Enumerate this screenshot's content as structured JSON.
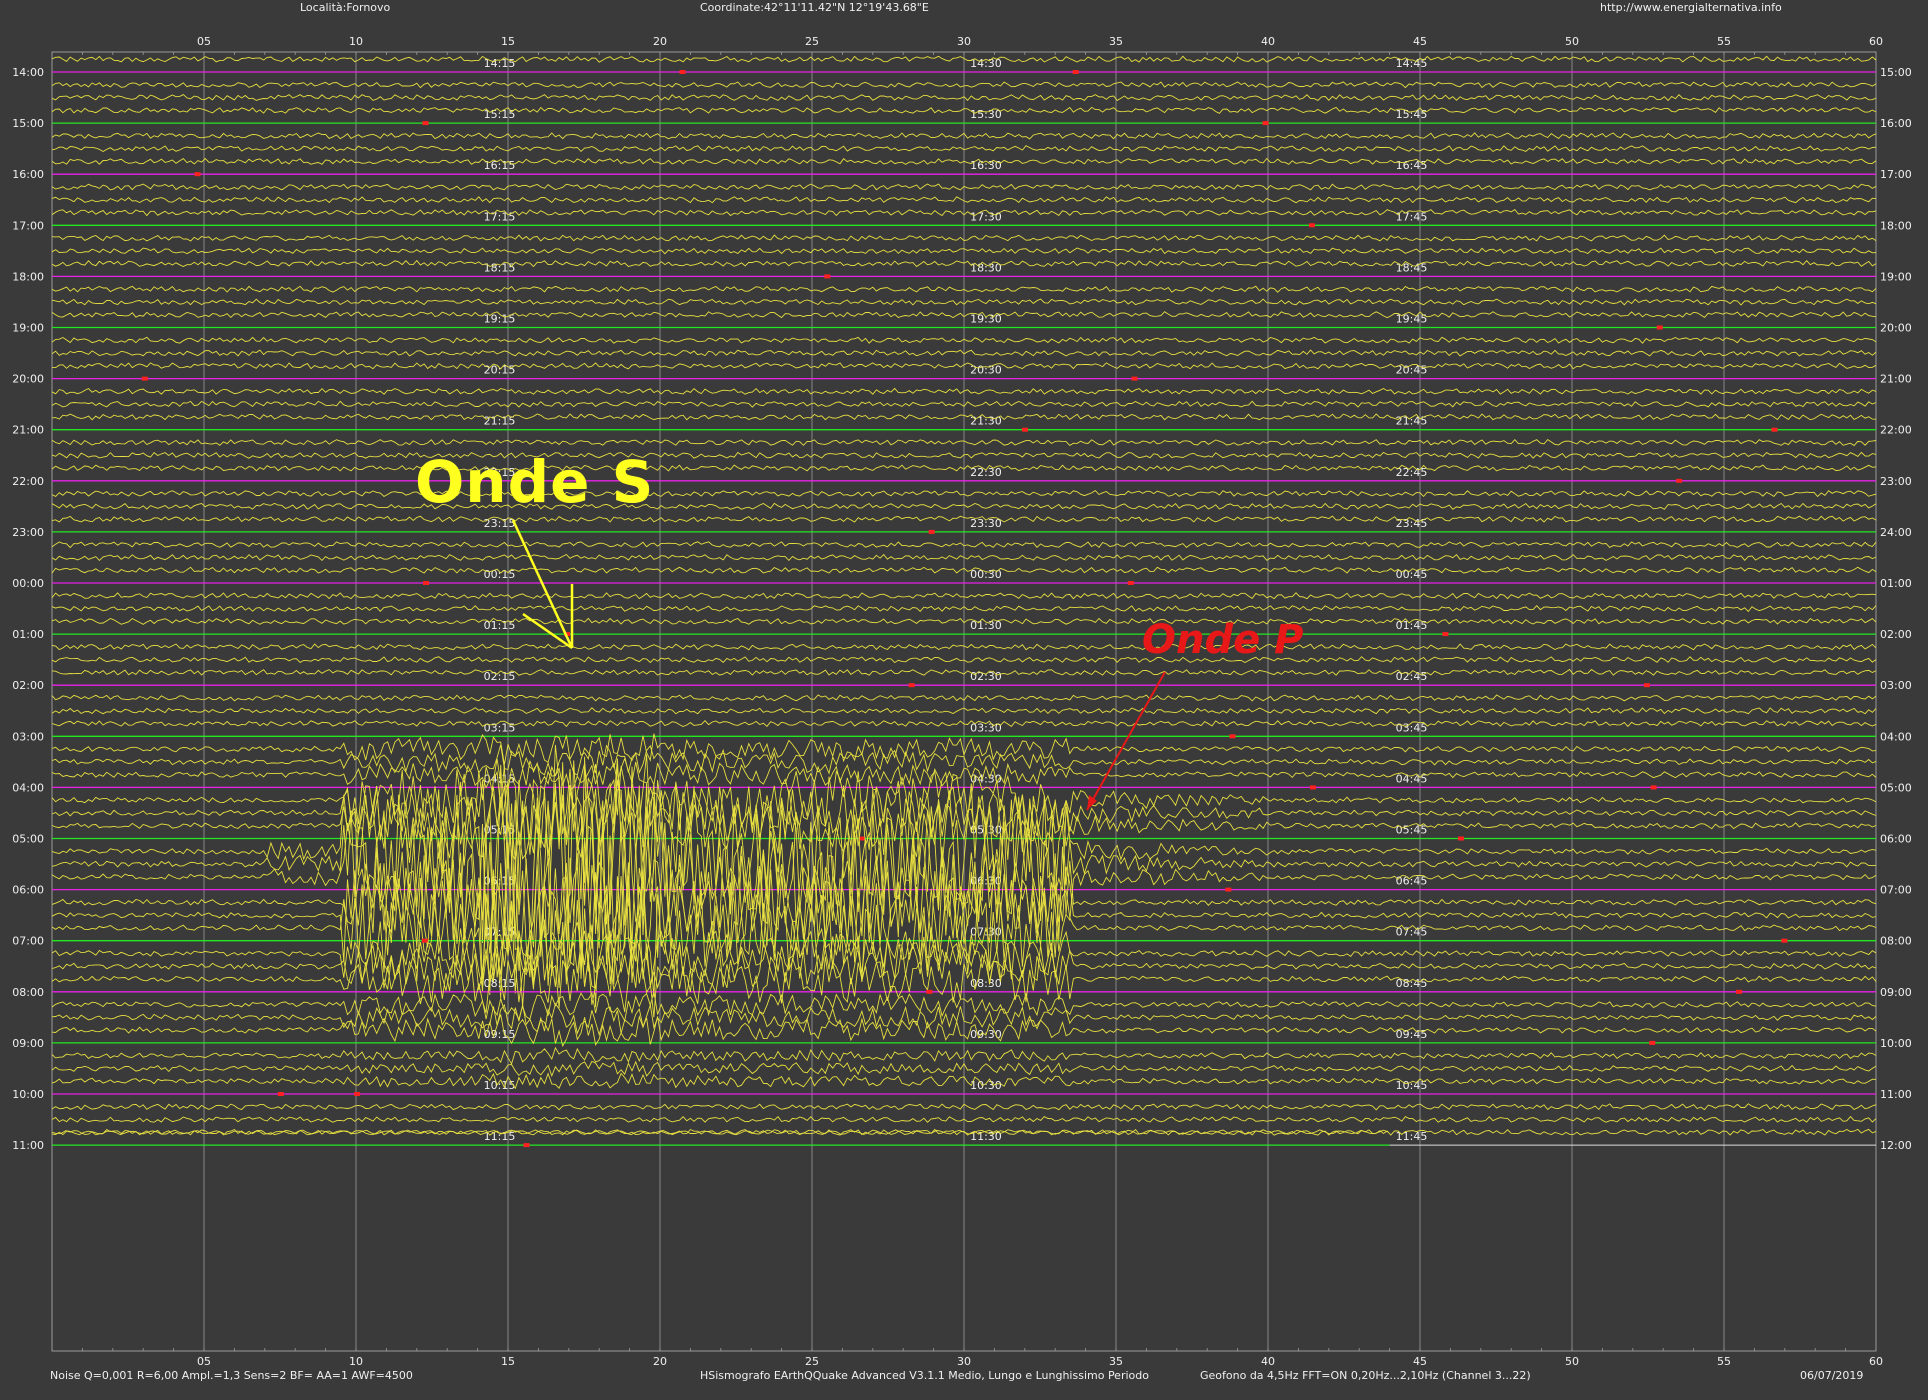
{
  "header": {
    "location": "Località:Fornovo",
    "coordinates": "Coordinate:42°11'11.42\"N  12°19'43.68\"E",
    "website": "http://www.energialternativa.info"
  },
  "footer": {
    "settings": "Noise Q=0,001 R=6,00 Ampl.=1,3 Sens=2 BF= AA=1 AWF=4500",
    "software": "HSismografo  EArthQQuake Advanced V3.1.1  Medio, Lungo e Lunghissimo Periodo",
    "sensor": "Geofono da 4,5Hz FFT=ON 0,20Hz...2,10Hz      (Channel 3...22)",
    "date": "06/07/2019"
  },
  "minute_ticks": [
    "05",
    "10",
    "15",
    "20",
    "25",
    "30",
    "35",
    "40",
    "45",
    "50",
    "55",
    "60"
  ],
  "left_hours": [
    "14:00",
    "15:00",
    "16:00",
    "17:00",
    "18:00",
    "19:00",
    "20:00",
    "21:00",
    "22:00",
    "23:00",
    "00:00",
    "01:00",
    "02:00",
    "03:00",
    "04:00",
    "05:00",
    "06:00",
    "07:00",
    "08:00",
    "09:00",
    "10:00",
    "11:00"
  ],
  "right_hours": [
    "15:00",
    "16:00",
    "17:00",
    "18:00",
    "19:00",
    "20:00",
    "21:00",
    "22:00",
    "23:00",
    "24:00",
    "01:00",
    "02:00",
    "03:00",
    "04:00",
    "05:00",
    "06:00",
    "07:00",
    "08:00",
    "09:00",
    "10:00",
    "11:00",
    "12:00"
  ],
  "quarter_labels": [
    [
      "14:15",
      "14:30",
      "14:45"
    ],
    [
      "15:15",
      "15:30",
      "15:45"
    ],
    [
      "16:15",
      "16:30",
      "16:45"
    ],
    [
      "17:15",
      "17:30",
      "17:45"
    ],
    [
      "18:15",
      "18:30",
      "18:45"
    ],
    [
      "19:15",
      "19:30",
      "19:45"
    ],
    [
      "20:15",
      "20:30",
      "20:45"
    ],
    [
      "21:15",
      "21:30",
      "21:45"
    ],
    [
      "22:15",
      "22:30",
      "22:45"
    ],
    [
      "23:15",
      "23:30",
      "23:45"
    ],
    [
      "00:15",
      "00:30",
      "00:45"
    ],
    [
      "01:15",
      "01:30",
      "01:45"
    ],
    [
      "02:15",
      "02:30",
      "02:45"
    ],
    [
      "03:15",
      "03:30",
      "03:45"
    ],
    [
      "04:15",
      "04:30",
      "04:45"
    ],
    [
      "05:15",
      "05:30",
      "05:45"
    ],
    [
      "06:15",
      "06:30",
      "06:45"
    ],
    [
      "07:15",
      "07:30",
      "07:45"
    ],
    [
      "08:15",
      "08:30",
      "08:45"
    ],
    [
      "09:15",
      "09:30",
      "09:45"
    ],
    [
      "10:15",
      "10:30",
      "10:45"
    ],
    [
      "11:15",
      "11:30",
      "11:45"
    ]
  ],
  "annotations": {
    "s_waves": "Onde S",
    "p_waves": "Onde P"
  },
  "colors": {
    "background": "#3a3a3a",
    "trace": "#e8e040",
    "hour_line_green": "#22e822",
    "hour_line_magenta": "#e822e8",
    "marker_red": "#ff2020",
    "grid": "#9a9a9a",
    "s_label": "#ffff20",
    "p_label": "#e81818"
  }
}
